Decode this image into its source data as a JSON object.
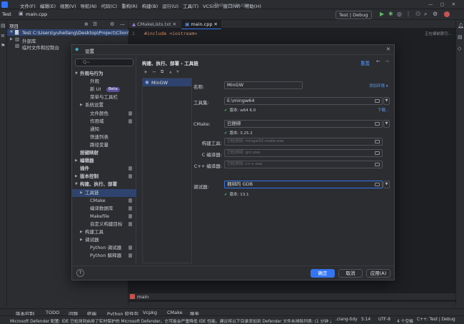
{
  "window": {
    "title": "Test - main.cpp",
    "menu": [
      "文件(F)",
      "编辑(E)",
      "视图(V)",
      "导航(N)",
      "代码(C)",
      "重构(R)",
      "构建(B)",
      "运行(U)",
      "工具(T)",
      "VCS(S)",
      "窗口(W)",
      "帮助(H)"
    ],
    "project_name": "Test",
    "run_config": "Test | Debug"
  },
  "editor": {
    "tabs": [
      "CMakeLists.txt",
      "main.cpp"
    ],
    "code_line": "#include <iostream>",
    "right_hint": "正在编制索引..."
  },
  "project_panel": {
    "title": "项目",
    "items": [
      "Test  C:\\Users\\yuhellang\\Desktop\\Project\\Clion\\Ope",
      "外部库",
      "临时文件和控制台"
    ]
  },
  "dialog": {
    "title": "设置",
    "breadcrumb": "构建、执行、部署  ›  工具链",
    "reset": "重置",
    "search_placeholder": "Q~",
    "nav": [
      {
        "label": "外观与行为",
        "bold": true,
        "arrow": "down",
        "indent": 0
      },
      {
        "label": "外观",
        "indent": 2
      },
      {
        "label": "新 UI",
        "indent": 2,
        "badge": "Beta"
      },
      {
        "label": "菜单与工具栏",
        "indent": 2
      },
      {
        "label": "系统设置",
        "indent": 1,
        "arrow": "right"
      },
      {
        "label": "文件颜色",
        "indent": 2,
        "mark": true
      },
      {
        "label": "作用域",
        "indent": 2,
        "mark": true
      },
      {
        "label": "通知",
        "indent": 2
      },
      {
        "label": "快速列表",
        "indent": 2
      },
      {
        "label": "路径变量",
        "indent": 2
      },
      {
        "label": "按键映射",
        "bold": true,
        "indent": 0
      },
      {
        "label": "编辑器",
        "bold": true,
        "arrow": "right",
        "indent": 0
      },
      {
        "label": "插件",
        "bold": true,
        "indent": 0,
        "mark": true
      },
      {
        "label": "版本控制",
        "bold": true,
        "arrow": "right",
        "indent": 0,
        "mark": true
      },
      {
        "label": "构建、执行、部署",
        "bold": true,
        "arrow": "down",
        "indent": 0
      },
      {
        "label": "工具链",
        "indent": 1,
        "arrow": "right",
        "selected": true
      },
      {
        "label": "CMake",
        "indent": 2,
        "mark": true
      },
      {
        "label": "编译数据库",
        "indent": 2,
        "mark": true
      },
      {
        "label": "Makefile",
        "indent": 2,
        "mark": true
      },
      {
        "label": "自定义构建目标",
        "indent": 2,
        "mark": true
      },
      {
        "label": "构建工具",
        "indent": 1,
        "arrow": "right"
      },
      {
        "label": "调试器",
        "indent": 1,
        "arrow": "right"
      },
      {
        "label": "Python 调试器",
        "indent": 2,
        "mark": true
      },
      {
        "label": "Python 解释器",
        "indent": 2,
        "mark": true
      }
    ],
    "toolchain": {
      "selected": "MinGW",
      "add": "+",
      "remove": "−",
      "copy": "⧉",
      "up": "▲",
      "down": "▼"
    },
    "form": {
      "name_label": "名称:",
      "name_value": "MinGW",
      "add_env": "添加环境 ▾",
      "toolset_label": "工具集:",
      "toolset_value": "E:\\mingw64",
      "toolset_ok": "版本: w64 6.0",
      "download": "下载...",
      "cmake_label": "CMake:",
      "cmake_value": "已捆绑",
      "cmake_ok": "版本: 3.25.2",
      "build_tool_label": "构建工具:",
      "build_tool_value": "已检测到: mingw32-make.exe",
      "c_label": "C 编译器:",
      "c_value": "已检测到: gcc.exe",
      "cxx_label": "C++ 编译器:",
      "cxx_value": "已检测到: c++.exe",
      "debugger_label": "调试器:",
      "debugger_value": "捆绑的 GDB",
      "debugger_ok": "版本: 13.1"
    },
    "buttons": {
      "ok": "确定",
      "cancel": "取消",
      "apply": "应用(A)",
      "help": "?"
    }
  },
  "bottom_tabs": [
    "版本控制",
    "TODO",
    "问题",
    "终端",
    "Python 软件包",
    "Vcpkg",
    "CMake",
    "服务"
  ],
  "bottom_file": "main",
  "status": {
    "message": "Microsoft Defender 配置: IDE 已检测到启用了实时保护的 Microsoft Defender。它可能会严重降低 IDE 性能。建议将以下目录添加到 Defender 文件夹排除列表: (1 分钟 之前)",
    "tidy": ".clang-tidy",
    "pos": "5:14",
    "encoding": "UTF-8",
    "indent": "4 个空格",
    "config": "C++: Test | Debug"
  }
}
